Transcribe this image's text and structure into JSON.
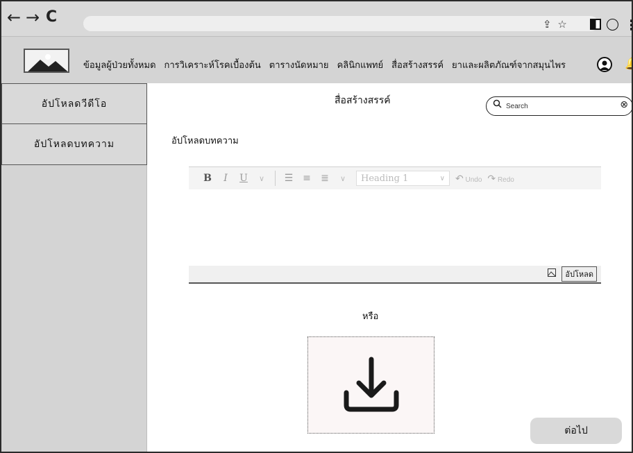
{
  "browser": {
    "back": "←",
    "forward": "→",
    "reload": "C",
    "share": "⇪",
    "star": "☆",
    "more": "⋮"
  },
  "nav": {
    "items": [
      "ข้อมูลผู้ป่วยทั้งหมด",
      "การวิเคราะห์โรคเบื้องต้น",
      "ตารางนัดหมาย",
      "คลินิกแพทย์",
      "สื่อสร้างสรรค์",
      "ยาและผลิตภัณฑ์จากสมุนไพร"
    ]
  },
  "sidebar": {
    "items": [
      "อัปโหลดวีดีโอ",
      "อัปโหลดบทความ"
    ]
  },
  "main": {
    "title": "สื่อสร้างสรรค์",
    "section_label": "อัปโหลดบทความ",
    "or_text": "หรือ",
    "next_label": "ต่อไป"
  },
  "search": {
    "placeholder": "Search"
  },
  "editor": {
    "bold": "B",
    "italic": "I",
    "underline": "U",
    "heading_value": "Heading 1",
    "undo_label": "Undo",
    "redo_label": "Redo",
    "upload_label": "อัปโหลด"
  },
  "colors": {
    "bar": "#d4d4d4",
    "dropzone_bg": "#fbf6f6",
    "button_bg": "#d9d9d9"
  }
}
